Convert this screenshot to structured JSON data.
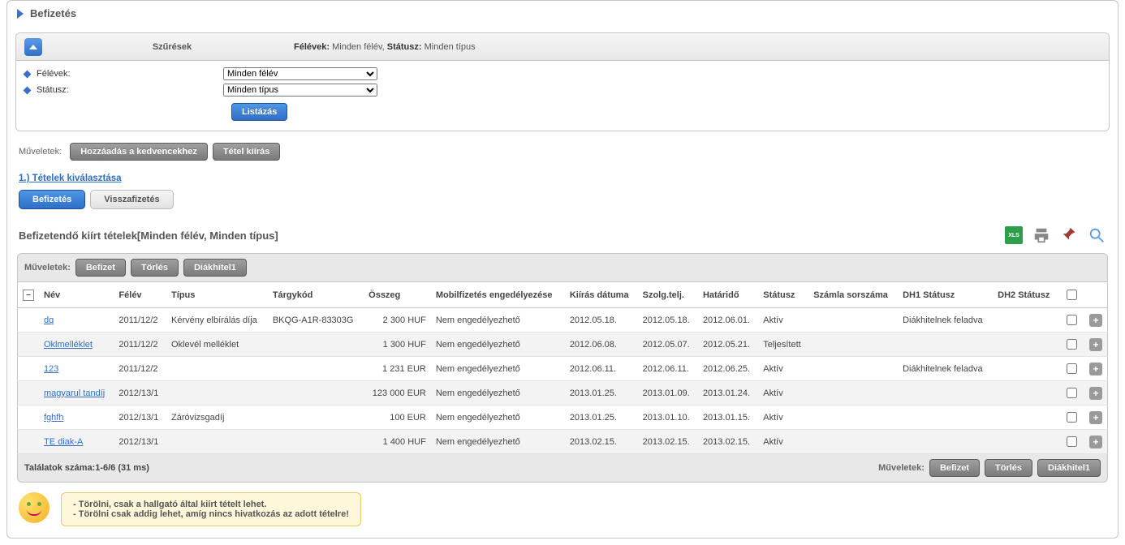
{
  "header": {
    "title": "Befizetés"
  },
  "filters": {
    "panel_label": "Szűrések",
    "summary_prefix1": "Félévek:",
    "summary_value1": "Minden félév",
    "summary_prefix2": "Státusz:",
    "summary_value2": "Minden típus",
    "row1_label": "Félévek:",
    "row1_value": "Minden félév",
    "row2_label": "Státusz:",
    "row2_value": "Minden típus",
    "list_button": "Listázás"
  },
  "ops_top": {
    "label": "Műveletek:",
    "btn_fav": "Hozzáadás a kedvencekhez",
    "btn_new": "Tétel kiírás"
  },
  "section_link": "1.) Tételek kiválasztása",
  "tabs": {
    "t1": "Befizetés",
    "t2": "Visszafizetés"
  },
  "list_title": "Befizetendő kiírt tételek[Minden félév, Minden típus]",
  "grid_ops": {
    "label": "Műveletek:",
    "btn_pay": "Befizet",
    "btn_del": "Törlés",
    "btn_loan": "Diákhitel1"
  },
  "columns": {
    "name": "Név",
    "term": "Félév",
    "type": "Típus",
    "subject": "Tárgykód",
    "amount": "Összeg",
    "mobile": "Mobilfizetés engedélyezése",
    "issue": "Kiírás dátuma",
    "service": "Szolg.telj.",
    "deadline": "Határidő",
    "status": "Státusz",
    "invoice": "Számla sorszáma",
    "dh1": "DH1 Státusz",
    "dh2": "DH2 Státusz"
  },
  "rows": [
    {
      "name": "dq",
      "term": "2011/12/2",
      "type": "Kérvény elbírálás díja",
      "subject": "BKQG-A1R-83303G",
      "amount": "2 300 HUF",
      "mobile": "Nem engedélyezhető",
      "issue": "2012.05.18.",
      "service": "2012.05.18.",
      "deadline": "2012.06.01.",
      "status": "Aktív",
      "invoice": "",
      "dh1": "Diákhitelnek feladva",
      "dh2": ""
    },
    {
      "name": "Oklmelléklet",
      "term": "2011/12/2",
      "type": "Oklevél melléklet",
      "subject": "",
      "amount": "1 300 HUF",
      "mobile": "Nem engedélyezhető",
      "issue": "2012.06.08.",
      "service": "2012.05.07.",
      "deadline": "2012.05.21.",
      "status": "Teljesített",
      "invoice": "",
      "dh1": "",
      "dh2": ""
    },
    {
      "name": "123",
      "term": "2011/12/2",
      "type": "",
      "subject": "",
      "amount": "1 231 EUR",
      "mobile": "Nem engedélyezhető",
      "issue": "2012.06.11.",
      "service": "2012.06.11.",
      "deadline": "2012.06.25.",
      "status": "Aktív",
      "invoice": "",
      "dh1": "Diákhitelnek feladva",
      "dh2": ""
    },
    {
      "name": "magyarul tandíj",
      "term": "2012/13/1",
      "type": "",
      "subject": "",
      "amount": "123 000 EUR",
      "mobile": "Nem engedélyezhető",
      "issue": "2013.01.25.",
      "service": "2013.01.09.",
      "deadline": "2013.01.24.",
      "status": "Aktív",
      "invoice": "",
      "dh1": "",
      "dh2": ""
    },
    {
      "name": "fghfh",
      "term": "2012/13/1",
      "type": "Záróvizsgadíj",
      "subject": "",
      "amount": "100 EUR",
      "mobile": "Nem engedélyezhető",
      "issue": "2013.01.25.",
      "service": "2013.01.10.",
      "deadline": "2013.01.15.",
      "status": "Aktív",
      "invoice": "",
      "dh1": "",
      "dh2": ""
    },
    {
      "name": "TE diak-A",
      "term": "2012/13/1",
      "type": "",
      "subject": "",
      "amount": "1 400 HUF",
      "mobile": "Nem engedélyezhető",
      "issue": "2013.02.15.",
      "service": "2013.02.15.",
      "deadline": "2013.02.15.",
      "status": "Aktív",
      "invoice": "",
      "dh1": "",
      "dh2": ""
    }
  ],
  "footer": {
    "results": "Találatok száma:1-6/6 (31 ms)",
    "ops_label": "Műveletek:",
    "btn_pay": "Befizet",
    "btn_del": "Törlés",
    "btn_loan": "Diákhitel1"
  },
  "tips": {
    "line1": "Törölni, csak a hallgató által kiírt tételt lehet.",
    "line2": "Törölni csak addig lehet, amíg nincs hivatkozás az adott tételre!"
  }
}
